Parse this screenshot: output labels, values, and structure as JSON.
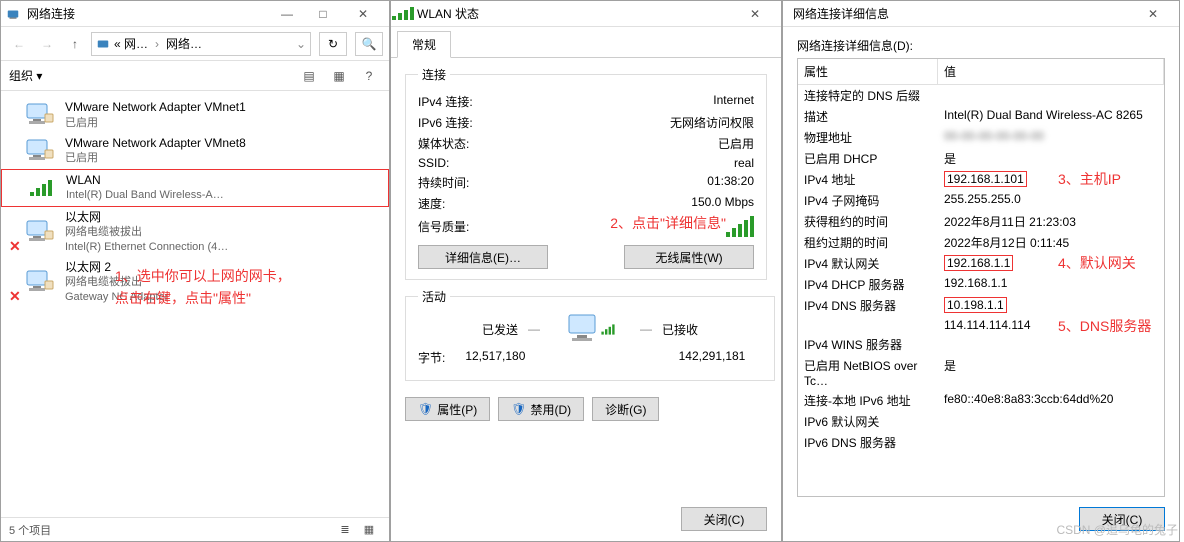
{
  "w1": {
    "title": "网络连接",
    "breadcrumb": {
      "pre": "« 网…",
      "cur": "网络…"
    },
    "searchPlaceholder": "",
    "toolbar": {
      "org": "组织 ▾"
    },
    "items": [
      {
        "name": "VMware Network Adapter VMnet1",
        "sub": "已启用",
        "icon": "net-ok"
      },
      {
        "name": "VMware Network Adapter VMnet8",
        "sub": "已启用",
        "icon": "net-ok"
      },
      {
        "name": "WLAN",
        "sub": "Intel(R) Dual Band Wireless-A…",
        "icon": "wlan",
        "boxed": true
      },
      {
        "name": "以太网",
        "sub": "网络电缆被拔出\nIntel(R) Ethernet Connection (4…",
        "icon": "net-x"
      },
      {
        "name": "以太网 2",
        "sub": "网络电缆被拔出\nGateway NC Adapter",
        "icon": "net-x"
      }
    ],
    "status": "5 个项目",
    "annot1a": "1、选中你可以上网的网卡，",
    "annot1b": "点击右键，点击\"属性\""
  },
  "w2": {
    "title": "WLAN 状态",
    "tab": "常规",
    "conn_legend": "连接",
    "conn": [
      {
        "k": "IPv4 连接:",
        "v": "Internet"
      },
      {
        "k": "IPv6 连接:",
        "v": "无网络访问权限"
      },
      {
        "k": "媒体状态:",
        "v": "已启用"
      },
      {
        "k": "SSID:",
        "v": "real"
      },
      {
        "k": "持续时间:",
        "v": "01:38:20"
      },
      {
        "k": "速度:",
        "v": "150.0 Mbps"
      }
    ],
    "signal_label": "信号质量:",
    "btn_detail": "详细信息(E)…",
    "btn_wireless": "无线属性(W)",
    "activity_legend": "活动",
    "sent": "已发送",
    "recv": "已接收",
    "bytes_label": "字节:",
    "bytes_sent": "12,517,180",
    "bytes_recv": "142,291,181",
    "btn_prop": "属性(P)",
    "btn_disable": "禁用(D)",
    "btn_diag": "诊断(G)",
    "close": "关闭(C)",
    "annot2": "2、点击\"详细信息\""
  },
  "w3": {
    "title": "网络连接详细信息",
    "label": "网络连接详细信息(D):",
    "headers": {
      "prop": "属性",
      "val": "值"
    },
    "rows": [
      {
        "p": "连接特定的 DNS 后缀",
        "v": ""
      },
      {
        "p": "描述",
        "v": "Intel(R) Dual Band Wireless-AC 8265"
      },
      {
        "p": "物理地址",
        "v": "‎",
        "obscured": true
      },
      {
        "p": "已启用 DHCP",
        "v": "是"
      },
      {
        "p": "IPv4 地址",
        "v": "192.168.1.101",
        "box": true,
        "annot": "3、主机IP"
      },
      {
        "p": "IPv4 子网掩码",
        "v": "255.255.255.0"
      },
      {
        "p": "获得租约的时间",
        "v": "2022年8月11日 21:23:03"
      },
      {
        "p": "租约过期的时间",
        "v": "2022年8月12日 0:11:45"
      },
      {
        "p": "IPv4 默认网关",
        "v": "192.168.1.1",
        "box": true,
        "annot": "4、默认网关"
      },
      {
        "p": "IPv4 DHCP 服务器",
        "v": "192.168.1.1"
      },
      {
        "p": "IPv4 DNS 服务器",
        "v": "10.198.1.1",
        "box": true
      },
      {
        "p": "",
        "v": "114.114.114.114",
        "annot": "5、DNS服务器"
      },
      {
        "p": "IPv4 WINS 服务器",
        "v": ""
      },
      {
        "p": "已启用 NetBIOS over Tc…",
        "v": "是"
      },
      {
        "p": "连接-本地 IPv6 地址",
        "v": "fe80::40e8:8a83:3ccb:64dd%20"
      },
      {
        "p": "IPv6 默认网关",
        "v": ""
      },
      {
        "p": "IPv6 DNS 服务器",
        "v": ""
      }
    ],
    "close": "关闭(C)"
  },
  "watermark": "CSDN @追乌龟的兔子"
}
